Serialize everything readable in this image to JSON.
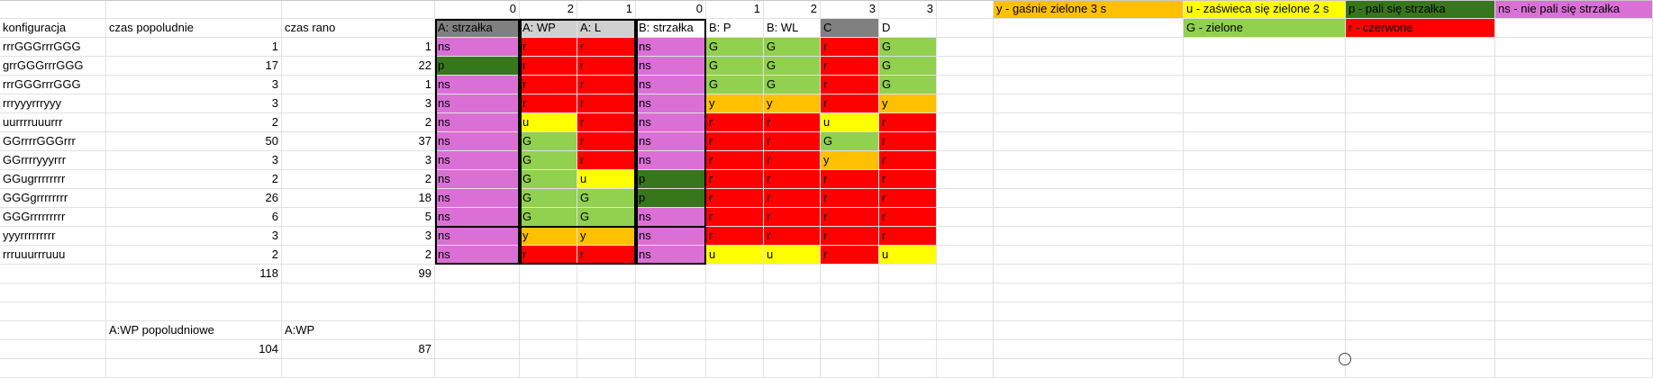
{
  "sheet": {
    "header_row": {
      "col_values": [
        "0",
        "2",
        "1",
        "0",
        "1",
        "2",
        "3",
        "3"
      ],
      "legend": [
        {
          "text": "y - gaśnie zielone 3 s",
          "color": "#FFC000"
        },
        {
          "text": "u - zaświeca się zielone 2 s",
          "color": "#FFFF00"
        },
        {
          "text": "p - pali się strzałka",
          "color": "#38761D"
        },
        {
          "text": "ns - nie pali się strzałka",
          "color": "#DA70D6"
        }
      ]
    },
    "column_headers": [
      "konfiguracja",
      "czas popoludnie",
      "czas rano",
      "A: strzałka",
      "A: WP",
      "A: L",
      "B: strzałka",
      "B: P",
      "B: WL",
      "C",
      "D"
    ],
    "legend_row2": [
      {
        "text": "G - zielone",
        "color": "#92D050"
      },
      {
        "text": "r - czerwone",
        "color": "#FF0000"
      }
    ],
    "rows": [
      {
        "konfiguracja": "rrrGGGrrrGGG",
        "popoludnie": "1",
        "rano": "1",
        "signals": [
          "ns",
          "r",
          "r",
          "ns",
          "G",
          "G",
          "r",
          "G"
        ]
      },
      {
        "konfiguracja": "grrGGGrrrGGG",
        "popoludnie": "17",
        "rano": "22",
        "signals": [
          "p",
          "r",
          "r",
          "ns",
          "G",
          "G",
          "r",
          "G"
        ]
      },
      {
        "konfiguracja": "rrrGGGrrrGGG",
        "popoludnie": "3",
        "rano": "1",
        "signals": [
          "ns",
          "r",
          "r",
          "ns",
          "G",
          "G",
          "r",
          "G"
        ]
      },
      {
        "konfiguracja": "rrryyyrrryyy",
        "popoludnie": "3",
        "rano": "3",
        "signals": [
          "ns",
          "r",
          "r",
          "ns",
          "y",
          "y",
          "r",
          "y"
        ]
      },
      {
        "konfiguracja": "uurrrruuurrr",
        "popoludnie": "2",
        "rano": "2",
        "signals": [
          "ns",
          "u",
          "r",
          "ns",
          "r",
          "r",
          "u",
          "r"
        ]
      },
      {
        "konfiguracja": "GGrrrrGGGrrr",
        "popoludnie": "50",
        "rano": "37",
        "signals": [
          "ns",
          "G",
          "r",
          "ns",
          "r",
          "r",
          "G",
          "r"
        ]
      },
      {
        "konfiguracja": "GGrrrryyyrrr",
        "popoludnie": "3",
        "rano": "3",
        "signals": [
          "ns",
          "G",
          "r",
          "ns",
          "r",
          "r",
          "y",
          "r"
        ]
      },
      {
        "konfiguracja": "GGugrrrrrrrr",
        "popoludnie": "2",
        "rano": "2",
        "signals": [
          "ns",
          "G",
          "u",
          "p",
          "r",
          "r",
          "r",
          "r"
        ]
      },
      {
        "konfiguracja": "GGGgrrrrrrrr",
        "popoludnie": "26",
        "rano": "18",
        "signals": [
          "ns",
          "G",
          "G",
          "p",
          "r",
          "r",
          "r",
          "r"
        ]
      },
      {
        "konfiguracja": "GGGrrrrrrrrr",
        "popoludnie": "6",
        "rano": "5",
        "signals": [
          "ns",
          "G",
          "G",
          "ns",
          "r",
          "r",
          "r",
          "r"
        ]
      },
      {
        "konfiguracja": "yyyrrrrrrrrr",
        "popoludnie": "3",
        "rano": "3",
        "signals": [
          "ns",
          "y",
          "y",
          "ns",
          "r",
          "r",
          "r",
          "r"
        ]
      },
      {
        "konfiguracja": "rrruuurrruuu",
        "popoludnie": "2",
        "rano": "2",
        "signals": [
          "ns",
          "r",
          "r",
          "ns",
          "u",
          "u",
          "r",
          "u"
        ]
      }
    ],
    "totals": {
      "popoludnie": "118",
      "rano": "99"
    },
    "wp": {
      "label_popoludnie": "A:WP popoludniowe",
      "label_rano": "A:WP",
      "value_popoludnie": "104",
      "value_rano": "87"
    },
    "colors": {
      "ns": "#DA70D6",
      "p": "#38761D",
      "G": "#92D050",
      "r": "#FF0000",
      "y": "#FFC000",
      "u": "#FFFF00",
      "header_gray": "#808080",
      "grid": "#e1e1e1"
    }
  }
}
